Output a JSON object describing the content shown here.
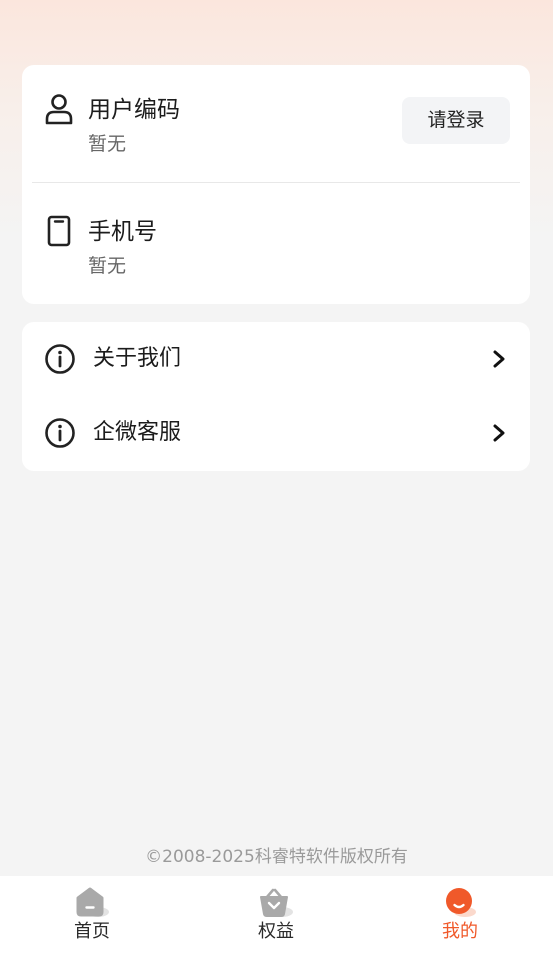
{
  "profile": {
    "user_code_label": "用户编码",
    "user_code_value": "暂无",
    "login_button": "请登录",
    "phone_label": "手机号",
    "phone_value": "暂无"
  },
  "menu": {
    "items": [
      {
        "label": "关于我们",
        "icon": "info-icon"
      },
      {
        "label": "企微客服",
        "icon": "info-icon"
      }
    ]
  },
  "footer": {
    "copyright": "©2008-2025科睿特软件版权所有"
  },
  "tabbar": {
    "active_color": "#f0592a",
    "tabs": [
      {
        "label": "首页",
        "icon": "home-icon",
        "active": false
      },
      {
        "label": "权益",
        "icon": "basket-icon",
        "active": false
      },
      {
        "label": "我的",
        "icon": "profile-icon",
        "active": true
      }
    ]
  }
}
